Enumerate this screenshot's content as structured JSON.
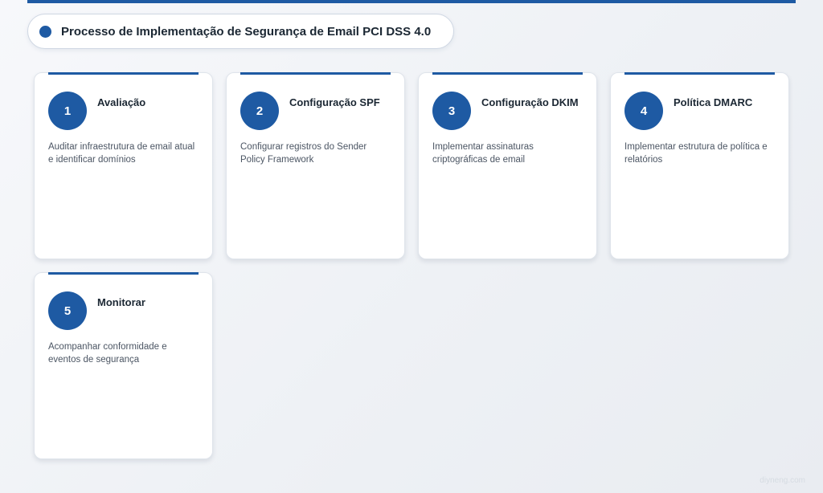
{
  "header": {
    "title": "Processo de Implementação de Segurança de Email PCI DSS 4.0"
  },
  "steps": [
    {
      "number": "1",
      "title": "Avaliação",
      "description": "Auditar infraestrutura de email atual e identificar domínios"
    },
    {
      "number": "2",
      "title": "Configuração SPF",
      "description": "Configurar registros do Sender Policy Framework"
    },
    {
      "number": "3",
      "title": "Configuração DKIM",
      "description": "Implementar assinaturas criptográficas de email"
    },
    {
      "number": "4",
      "title": "Política DMARC",
      "description": "Implementar estrutura de política e relatórios"
    },
    {
      "number": "5",
      "title": "Monitorar",
      "description": "Acompanhar conformidade e eventos de segurança"
    }
  ],
  "footer": {
    "watermark": "diyneng.com"
  },
  "colors": {
    "accent": "#1e5aa3",
    "background": "#f2f4f7",
    "card": "#ffffff"
  }
}
